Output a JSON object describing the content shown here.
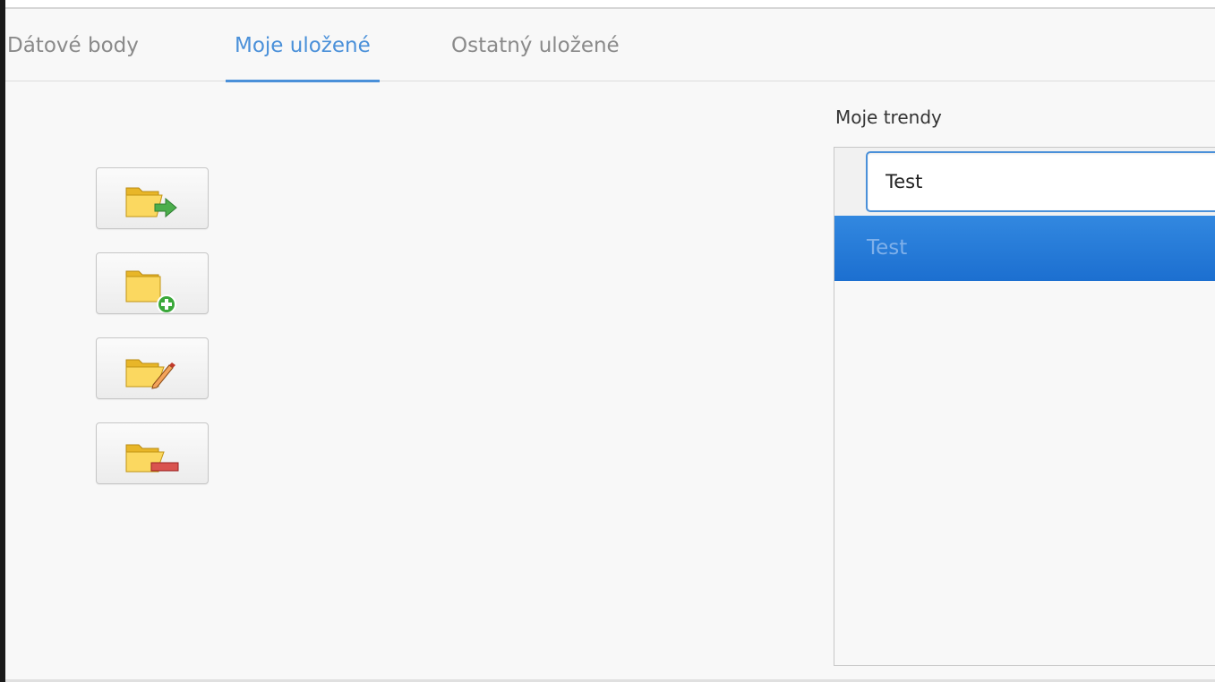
{
  "tabs": [
    {
      "label": "Dátové body",
      "active": false
    },
    {
      "label": "Moje uložené",
      "active": true
    },
    {
      "label": "Ostatný uložené",
      "active": false
    }
  ],
  "toolbar": {
    "buttons": [
      {
        "icon": "folder-open-arrow-icon"
      },
      {
        "icon": "folder-add-icon"
      },
      {
        "icon": "folder-edit-icon"
      },
      {
        "icon": "folder-remove-icon"
      }
    ]
  },
  "trends": {
    "label": "Moje trendy",
    "search_value": "Test",
    "items": [
      "Test"
    ]
  },
  "colors": {
    "accent": "#4a90d9",
    "selection": "#1c6fd0",
    "folder": "#f5c842"
  }
}
